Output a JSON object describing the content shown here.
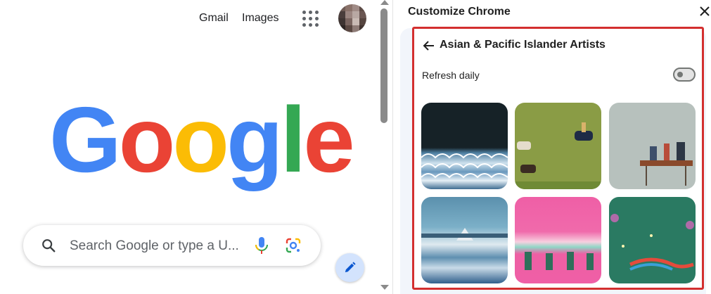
{
  "ntp": {
    "links": {
      "gmail": "Gmail",
      "images": "Images"
    },
    "logo_letters": [
      {
        "char": "G",
        "color": "#4285F4"
      },
      {
        "char": "o",
        "color": "#EA4335"
      },
      {
        "char": "o",
        "color": "#FBBC05"
      },
      {
        "char": "g",
        "color": "#4285F4"
      },
      {
        "char": "l",
        "color": "#34A853"
      },
      {
        "char": "e",
        "color": "#EA4335"
      }
    ],
    "search": {
      "placeholder": "Search Google or type a U..."
    },
    "icons": {
      "apps": "apps-grid-icon",
      "search": "search-icon",
      "mic": "microphone-icon",
      "lens": "google-lens-icon",
      "edit": "pencil-icon"
    }
  },
  "panel": {
    "title": "Customize Chrome",
    "collection_title": "Asian & Pacific Islander Artists",
    "refresh_label": "Refresh daily",
    "refresh_enabled": false,
    "highlight_color": "#d32f2f",
    "icons": {
      "close": "close-icon",
      "back": "back-arrow-icon"
    },
    "backgrounds": [
      {
        "id": "waves"
      },
      {
        "id": "riders"
      },
      {
        "id": "market"
      },
      {
        "id": "mountain-sea"
      },
      {
        "id": "pink-parade"
      },
      {
        "id": "green-garden"
      }
    ]
  }
}
